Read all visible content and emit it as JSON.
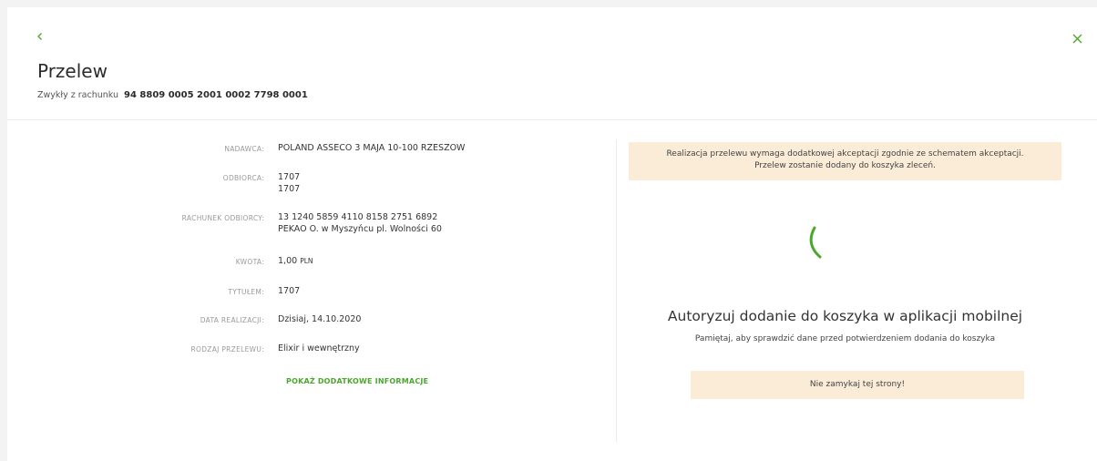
{
  "header": {
    "title": "Przelew",
    "subtitle_label": "Zwykły z rachunku",
    "account_number": "94 8809 0005 2001 0002 7798 0001"
  },
  "colors": {
    "accent": "#4aa82b",
    "notice_bg": "#faecd6"
  },
  "icons": {
    "back": "chevron-left-icon",
    "close": "close-icon",
    "spinner": "loading-spinner"
  },
  "details": {
    "sender": {
      "label": "NADAWCA:",
      "value": "POLAND ASSECO 3 MAJA 10-100 RZESZOW"
    },
    "recipient": {
      "label": "ODBIORCA:",
      "line1": "1707",
      "line2": "1707"
    },
    "recipient_account": {
      "label": "RACHUNEK ODBIORCY:",
      "line1": "13 1240 5859 4110 8158 2751 6892",
      "line2": "PEKAO O. w Myszyńcu  pl. Wolności 60"
    },
    "amount": {
      "label": "KWOTA:",
      "value": "1,00",
      "currency": "PLN"
    },
    "title": {
      "label": "TYTUŁEM:",
      "value": "1707"
    },
    "date": {
      "label": "DATA REALIZACJI:",
      "value": "Dzisiaj, 14.10.2020"
    },
    "type": {
      "label": "RODZAJ PRZELEWU:",
      "value": "Elixir i wewnętrzny"
    },
    "more_link": "POKAŻ DODATKOWE INFORMACJE"
  },
  "authorization": {
    "notice": "Realizacja przelewu wymaga dodatkowej akceptacji zgodnie ze schematem akceptacji. Przelew zostanie dodany do koszyka zleceń.",
    "title": "Autoryzuj dodanie do koszyka w aplikacji mobilnej",
    "hint": "Pamiętaj, aby sprawdzić dane przed potwierdzeniem dodania do koszyka",
    "warning": "Nie zamykaj tej strony!"
  }
}
